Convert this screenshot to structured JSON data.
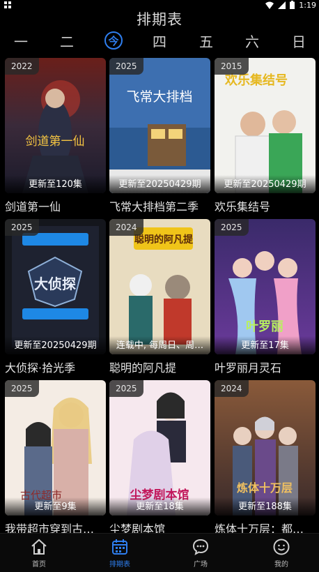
{
  "status": {
    "time": "1:19"
  },
  "header": {
    "title": "排期表"
  },
  "days": [
    {
      "label": "一"
    },
    {
      "label": "二"
    },
    {
      "label": "今"
    },
    {
      "label": "四"
    },
    {
      "label": "五"
    },
    {
      "label": "六"
    },
    {
      "label": "日"
    }
  ],
  "cards": [
    {
      "year": "2022",
      "update": "更新至120集",
      "name": "剑道第一仙",
      "poster_text": "剑道第一仙",
      "accent": "#c0392b"
    },
    {
      "year": "2025",
      "update": "更新至20250429期",
      "name": "飞常大排档第二季",
      "poster_text": "飞常大排档",
      "accent": "#2a6fb0"
    },
    {
      "year": "2015",
      "update": "更新至20250429期",
      "name": "欢乐集结号",
      "poster_text": "欢乐集结号",
      "accent": "#e6b820"
    },
    {
      "year": "2025",
      "update": "更新至20250429期",
      "name": "大侦探·拾光季",
      "poster_text": "大侦探",
      "accent": "#1e88e5"
    },
    {
      "year": "2024",
      "update": "连载中, 每周日、周…",
      "name": "聪明的阿凡提",
      "poster_text": "聪明的阿凡提",
      "accent": "#f0c419"
    },
    {
      "year": "2025",
      "update": "更新至17集",
      "name": "叶罗丽月灵石",
      "poster_text": "叶罗丽",
      "accent": "#7b5cc4"
    },
    {
      "year": "2025",
      "update": "更新至9集",
      "name": "我带超市穿到古…",
      "poster_text": "古代超市",
      "accent": "#8e2a2a"
    },
    {
      "year": "2025",
      "update": "更新至18集",
      "name": "尘梦剧本馆",
      "poster_text": "尘梦剧本馆",
      "accent": "#c2185b"
    },
    {
      "year": "2024",
      "update": "更新至188集",
      "name": "炼体十万层：都…",
      "poster_text": "炼体十万层",
      "accent": "#b5651d"
    }
  ],
  "bottom_nav": [
    {
      "label": "首页",
      "icon": "home-icon"
    },
    {
      "label": "排期表",
      "icon": "calendar-icon"
    },
    {
      "label": "广场",
      "icon": "chat-icon"
    },
    {
      "label": "我的",
      "icon": "profile-icon"
    }
  ]
}
